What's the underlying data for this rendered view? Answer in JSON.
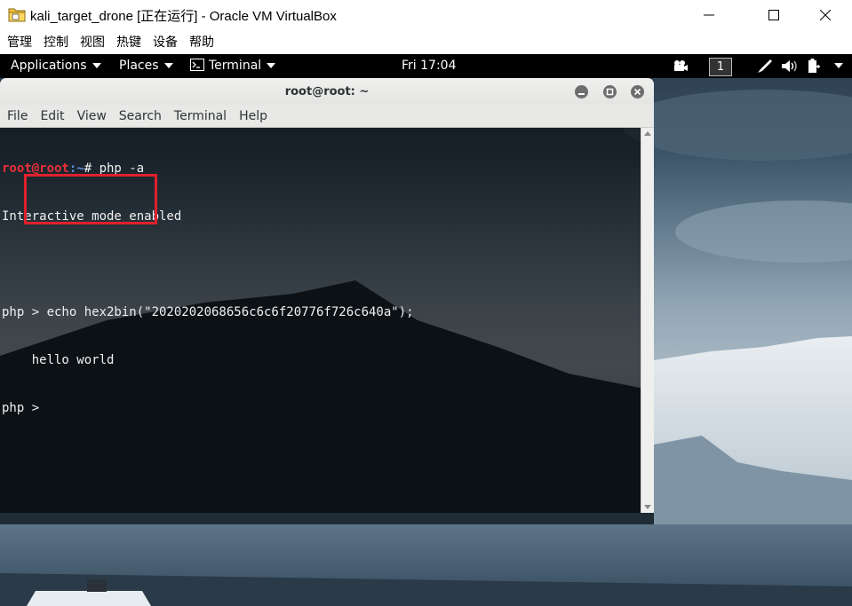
{
  "vbox": {
    "title": "kali_target_drone [正在运行] - Oracle VM VirtualBox",
    "menu": [
      "管理",
      "控制",
      "视图",
      "热键",
      "设备",
      "帮助"
    ]
  },
  "gnome_topbar": {
    "applications": "Applications",
    "places": "Places",
    "terminal": "Terminal",
    "clock": "Fri 17:04",
    "workspace": "1"
  },
  "terminal": {
    "title": "root@root: ~",
    "menu": [
      "File",
      "Edit",
      "View",
      "Search",
      "Terminal",
      "Help"
    ],
    "prompt_user": "root@root",
    "prompt_path": ":~",
    "prompt_end": "# ",
    "cmd1": "php -a",
    "lines": [
      "Interactive mode enabled",
      "",
      "php > echo hex2bin(\"2020202068656c6c6f20776f726c640a\");",
      "    hello world",
      "php > "
    ]
  },
  "colors": {
    "prompt_user": "#e8303a",
    "prompt_path": "#5f8be0",
    "highlight_box": "#e0212d"
  }
}
